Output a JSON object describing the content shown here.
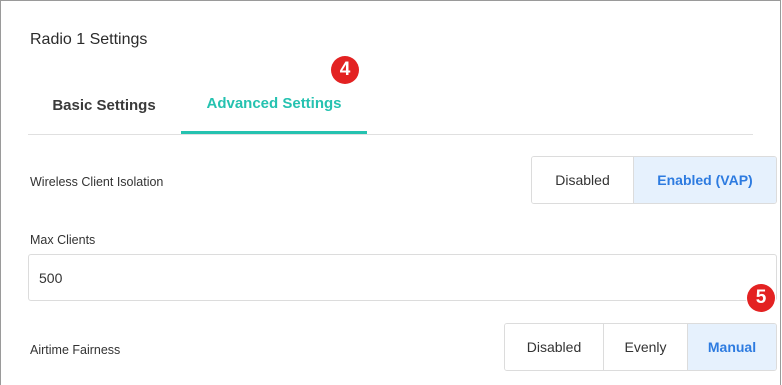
{
  "panel": {
    "title": "Radio 1 Settings"
  },
  "tabs": [
    {
      "label": "Basic Settings",
      "active": false
    },
    {
      "label": "Advanced Settings",
      "active": true
    }
  ],
  "markers": {
    "step4": "4",
    "step5": "5"
  },
  "wireless_client_isolation": {
    "label": "Wireless Client Isolation",
    "options": [
      "Disabled",
      "Enabled (VAP)"
    ],
    "selected": "Enabled (VAP)"
  },
  "max_clients": {
    "label": "Max Clients",
    "value": "500"
  },
  "airtime_fairness": {
    "label": "Airtime Fairness",
    "options": [
      "Disabled",
      "Evenly",
      "Manual"
    ],
    "selected": "Manual"
  },
  "colors": {
    "accent_tab": "#25c2b0",
    "selected_text": "#2d7be0",
    "selected_bg": "#e6f1fd",
    "marker": "#e32222"
  }
}
